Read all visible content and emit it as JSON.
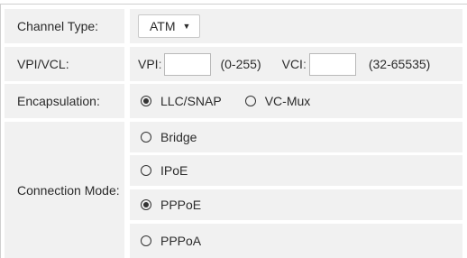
{
  "channel_type": {
    "label": "Channel Type:",
    "value": "ATM"
  },
  "vpi_vcl": {
    "label": "VPI/VCL:",
    "vpi_label": "VPI",
    "vpi_range": "(0-255)",
    "vci_label": "VCI",
    "vci_range": "(32-65535)",
    "vpi_value": "",
    "vci_value": ""
  },
  "encapsulation": {
    "label": "Encapsulation:",
    "options": [
      {
        "label": "LLC/SNAP",
        "selected": true
      },
      {
        "label": "VC-Mux",
        "selected": false
      }
    ]
  },
  "connection_mode": {
    "label": "Connection Mode:",
    "options": [
      {
        "label": "Bridge",
        "selected": false
      },
      {
        "label": "IPoE",
        "selected": false
      },
      {
        "label": "PPPoE",
        "selected": true
      },
      {
        "label": "PPPoA",
        "selected": false
      }
    ]
  }
}
